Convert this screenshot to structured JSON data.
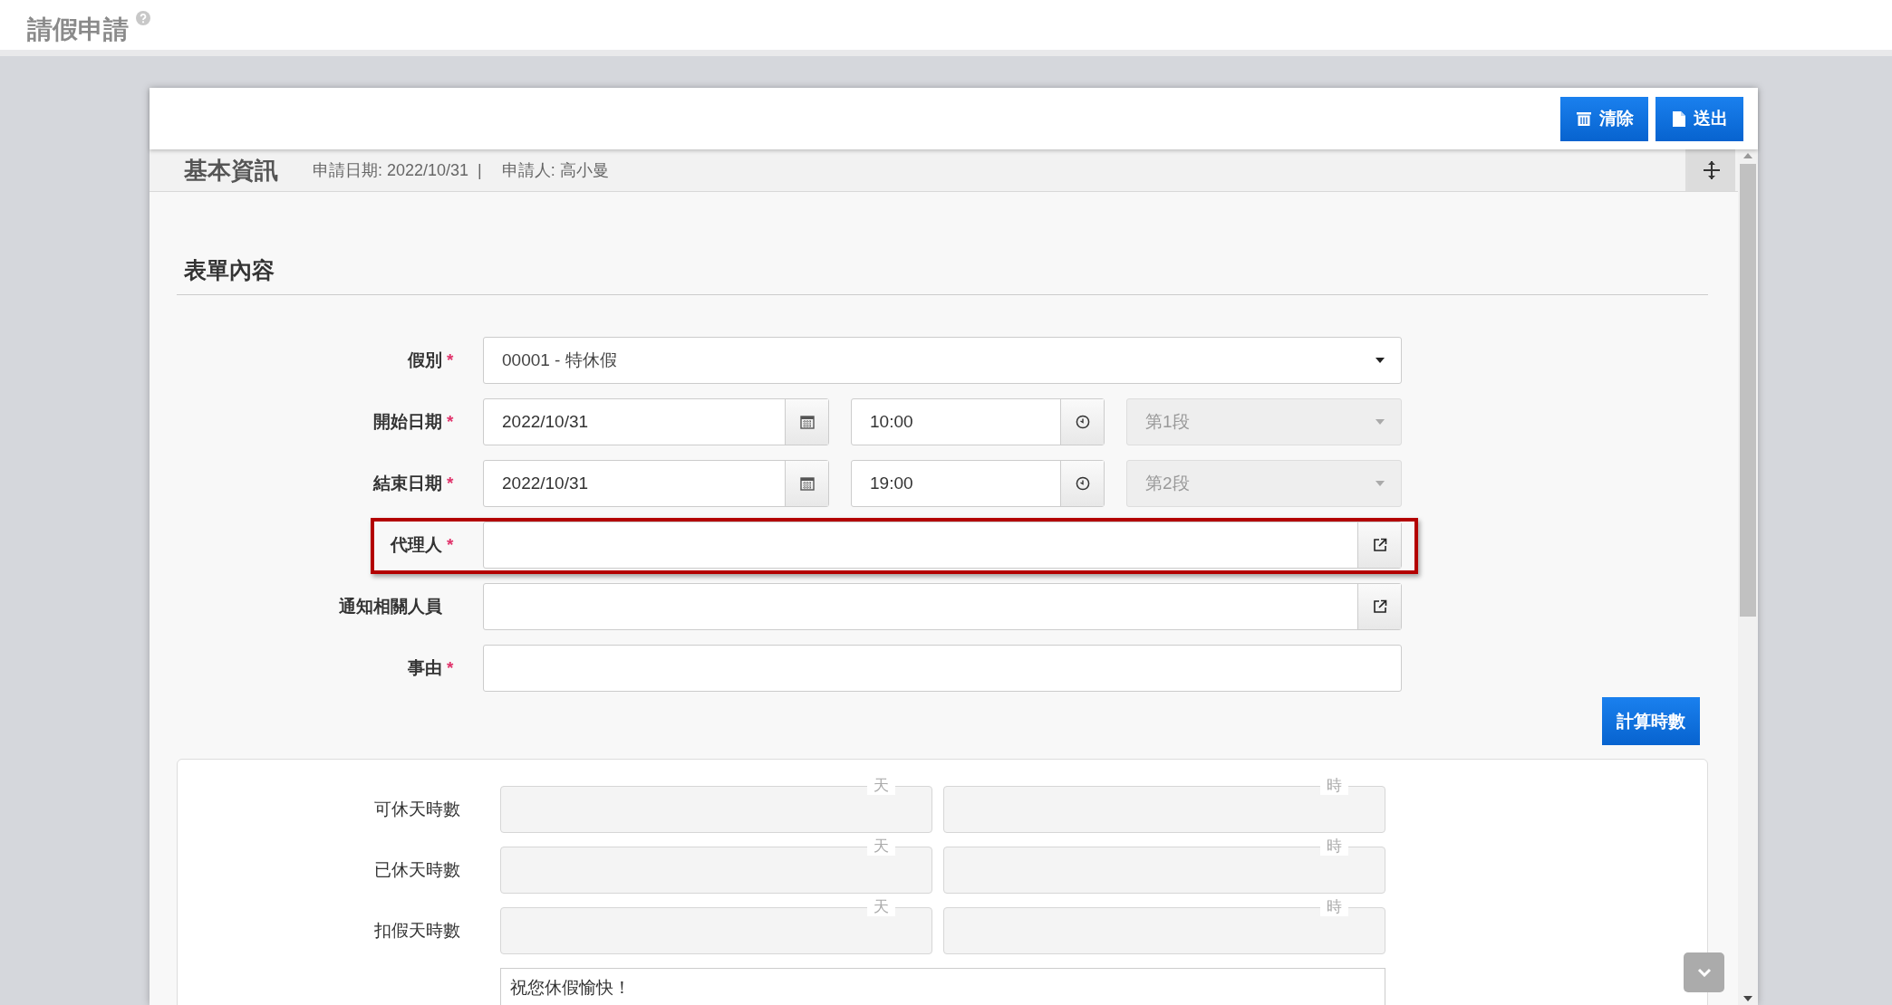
{
  "page": {
    "title": "請假申請"
  },
  "toolbar": {
    "buttons": [
      {
        "label": "清除",
        "kind": "clear"
      },
      {
        "label": "送出",
        "kind": "submit"
      }
    ]
  },
  "basic_info": {
    "title": "基本資訊",
    "apply_date": "申請日期: 2022/10/31",
    "separator": "|",
    "applicant": "申請人: 高小曼"
  },
  "form": {
    "title": "表單內容",
    "required_mark": "*",
    "fields": [
      {
        "kind": "select",
        "label": "假別",
        "required": true,
        "highlighted": false,
        "value": "00001 - 特休假"
      },
      {
        "kind": "datetime",
        "label": "開始日期",
        "required": true,
        "highlighted": false,
        "date": "2022/10/31",
        "time": "10:00",
        "segment": {
          "value": "第1段",
          "disabled": true
        }
      },
      {
        "kind": "datetime",
        "label": "結束日期",
        "required": true,
        "highlighted": false,
        "date": "2022/10/31",
        "time": "19:00",
        "segment": {
          "value": "第2段",
          "disabled": true
        }
      },
      {
        "kind": "picker",
        "label": "代理人",
        "required": true,
        "highlighted": true
      },
      {
        "kind": "picker",
        "label": "通知相關人員",
        "required": false,
        "highlighted": false
      },
      {
        "kind": "text",
        "label": "事由",
        "required": true,
        "highlighted": false
      }
    ]
  },
  "calc_button": "計算時數",
  "summary": {
    "rows": [
      {
        "label": "可休天時數",
        "day_unit": "天",
        "hour_unit": "時"
      },
      {
        "label": "已休天時數",
        "day_unit": "天",
        "hour_unit": "時"
      },
      {
        "label": "扣假天時數",
        "day_unit": "天",
        "hour_unit": "時"
      }
    ],
    "note": "祝您休假愉快！"
  }
}
